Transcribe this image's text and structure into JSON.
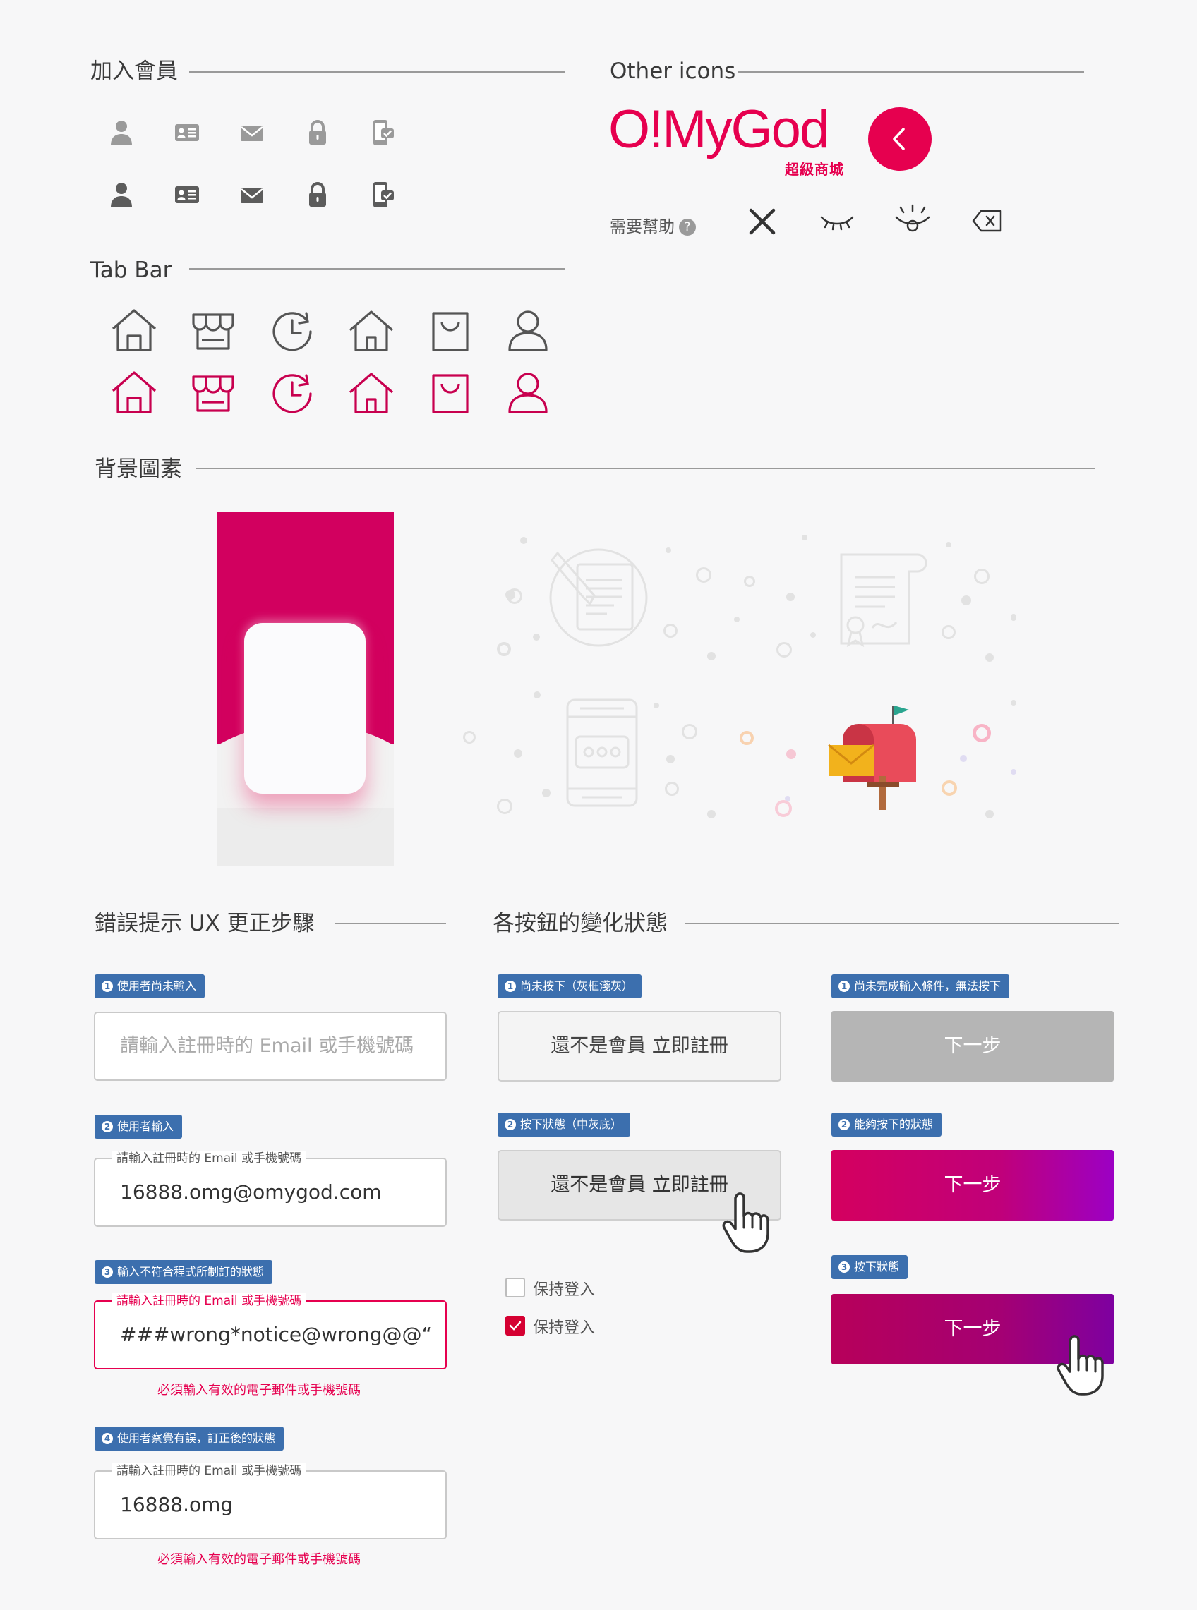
{
  "sections": {
    "member": "加入會員",
    "tabbar": "Tab Bar",
    "other": "Other icons",
    "background": "背景圖素",
    "error": "錯誤提示 UX 更正步驟",
    "buttons": "各按鈕的變化狀態"
  },
  "member_icons": [
    "user-icon",
    "id-card-icon",
    "mail-icon",
    "lock-icon",
    "phone-check-icon"
  ],
  "tab_icons": [
    "home-icon",
    "store-icon",
    "history-icon",
    "home-alt-icon",
    "bag-icon",
    "profile-icon"
  ],
  "colors": {
    "brand": "#e6004f",
    "tab_active": "#c8004f",
    "tag_blue": "#3c6fae",
    "error": "#e6004f"
  },
  "logo": {
    "text": "O!MyGod",
    "sub": "超級商城"
  },
  "help": {
    "label": "需要幫助",
    "q": "?"
  },
  "other_icons": [
    "close-icon",
    "eye-closed-icon",
    "eye-open-icon",
    "backspace-icon"
  ],
  "error_steps": {
    "step1": {
      "num": "1",
      "tag": "使用者尚未輸入",
      "placeholder": "請輸入註冊時的 Email 或手機號碼"
    },
    "step2": {
      "num": "2",
      "tag": "使用者輸入",
      "label": "請輸入註冊時的 Email 或手機號碼",
      "value": "16888.omg@omygod.com"
    },
    "step3": {
      "num": "3",
      "tag": "輸入不符合程式所制訂的狀態",
      "label": "請輸入註冊時的 Email 或手機號碼",
      "value": "###wrong*notice@wrong@@“",
      "error": "必須輸入有效的電子郵件或手機號碼"
    },
    "step4": {
      "num": "4",
      "tag": "使用者察覺有誤，訂正後的狀態",
      "label": "請輸入註冊時的 Email 或手機號碼",
      "value": "16888.omg",
      "error": "必須輸入有效的電子郵件或手機號碼"
    }
  },
  "button_states": {
    "ghost1": {
      "num": "1",
      "tag": "尚未按下（灰框淺灰）",
      "label": "還不是會員 立即註冊"
    },
    "ghost2": {
      "num": "2",
      "tag": "按下狀態（中灰底）",
      "label": "還不是會員 立即註冊"
    },
    "next1": {
      "num": "1",
      "tag": "尚未完成輸入條件，無法按下",
      "label": "下一步"
    },
    "next2": {
      "num": "2",
      "tag": "能夠按下的狀態",
      "label": "下一步"
    },
    "next3": {
      "num": "3",
      "tag": "按下狀態",
      "label": "下一步"
    },
    "keep_login_unchecked": "保持登入",
    "keep_login_checked": "保持登入"
  }
}
